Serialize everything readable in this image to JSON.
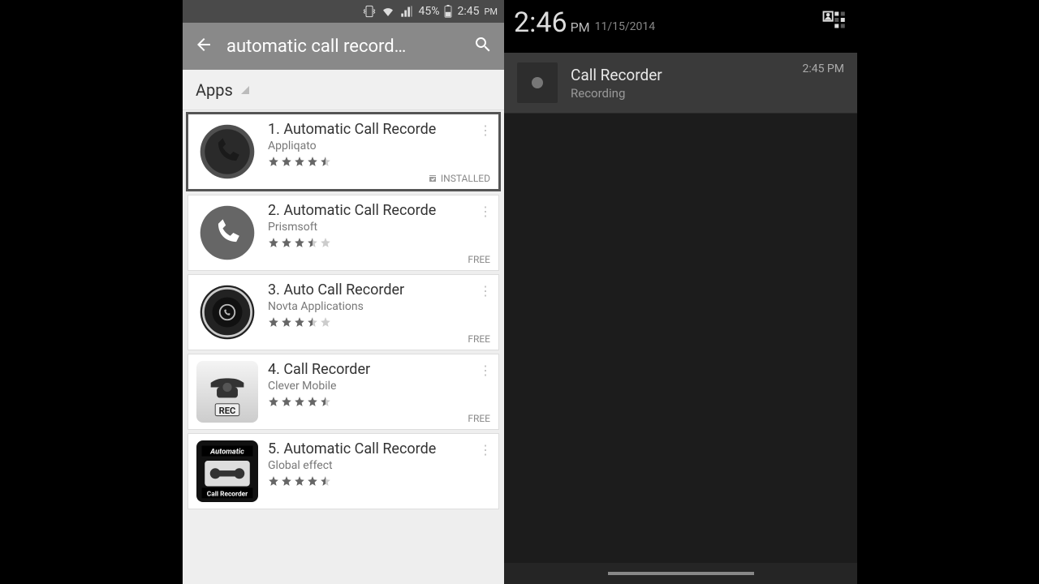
{
  "left": {
    "status": {
      "battery": "45%",
      "time": "2:45",
      "ampm": "PM"
    },
    "search": {
      "query": "automatic call record…"
    },
    "tab": "Apps",
    "apps": [
      {
        "title": "1. Automatic Call Recorde",
        "dev": "Appliqato",
        "rating": 4.5,
        "price": "INSTALLED",
        "highlight": true
      },
      {
        "title": "2. Automatic Call Recorde",
        "dev": "Prismsoft",
        "rating": 3.5,
        "price": "FREE"
      },
      {
        "title": "3. Auto Call Recorder",
        "dev": "Novta Applications",
        "rating": 3.5,
        "price": "FREE"
      },
      {
        "title": "4. Call Recorder",
        "dev": "Clever Mobile",
        "rating": 4.5,
        "price": "FREE"
      },
      {
        "title": "5. Automatic Call Recorde",
        "dev": "Global effect",
        "rating": 4.5,
        "price": ""
      }
    ],
    "icons": {
      "automatic_top": "Automatic",
      "automatic_bottom": "Call Recorder",
      "rec": "REC"
    }
  },
  "right": {
    "time": "2:46",
    "ampm": "PM",
    "date": "11/15/2014",
    "notif": {
      "title": "Call Recorder",
      "sub": "Recording",
      "time": "2:45 PM"
    }
  }
}
